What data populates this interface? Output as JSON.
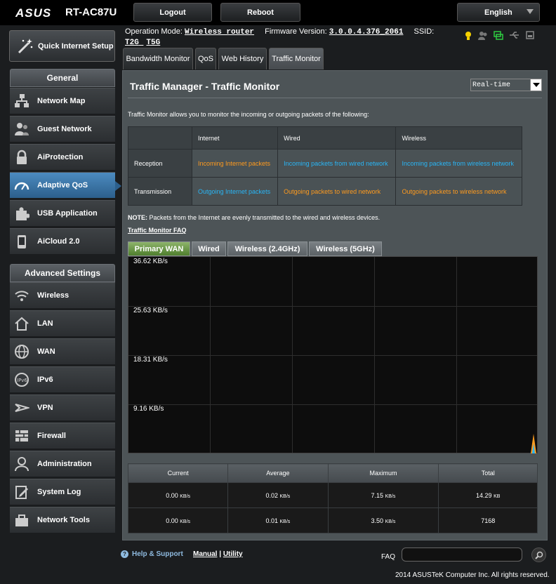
{
  "brand": {
    "logo": "ASUS",
    "model": "RT-AC87U"
  },
  "topbar": {
    "logout": "Logout",
    "reboot": "Reboot",
    "language": "English"
  },
  "sidebar": {
    "quick_setup": "Quick Internet Setup",
    "general_title": "General",
    "general_items": [
      "Network Map",
      "Guest Network",
      "AiProtection",
      "Adaptive QoS",
      "USB Application",
      "AiCloud 2.0"
    ],
    "advanced_title": "Advanced Settings",
    "advanced_items": [
      "Wireless",
      "LAN",
      "WAN",
      "IPv6",
      "VPN",
      "Firewall",
      "Administration",
      "System Log",
      "Network Tools"
    ]
  },
  "header": {
    "op_mode_label": "Operation Mode:",
    "op_mode_value": "Wireless router",
    "firmware_label": "Firmware Version:",
    "firmware_value": "3.0.0.4.376_2061",
    "ssid_label": "SSID:",
    "ssid_1": "T2G",
    "ssid_2": "T5G"
  },
  "tabs": [
    "Bandwidth Monitor",
    "QoS",
    "Web History",
    "Traffic Monitor"
  ],
  "main": {
    "title": "Traffic Manager - Traffic Monitor",
    "mode_select": "Real-time",
    "description": "Traffic Monitor allows you to monitor the incoming or outgoing packets of the following:",
    "legend": {
      "headers": [
        "Internet",
        "Wired",
        "Wireless"
      ],
      "rows": [
        {
          "label": "Reception",
          "cells": [
            "Incoming Internet packets",
            "Incoming packets from wired network",
            "Incoming packets from wireless network"
          ]
        },
        {
          "label": "Transmission",
          "cells": [
            "Outgoing Internet packets",
            "Outgoing packets to wired network",
            "Outgoing packets to wireless network"
          ]
        }
      ]
    },
    "note_bold": "NOTE:",
    "note": " Packets from the Internet are evenly transmitted to the wired and wireless devices.",
    "faq_link": "Traffic Monitor FAQ",
    "graph_tabs": [
      "Primary WAN",
      "Wired",
      "Wireless (2.4GHz)",
      "Wireless (5GHz)"
    ],
    "graph_labels": [
      "36.62 KB/s",
      "25.63 KB/s",
      "18.31 KB/s",
      "9.16 KB/s"
    ],
    "stats": {
      "headers": [
        "Current",
        "Average",
        "Maximum",
        "Total"
      ],
      "rx": {
        "current": "0.00",
        "average": "0.02",
        "maximum": "7.15",
        "total": "14.29",
        "total_unit": "KB"
      },
      "tx": {
        "current": "0.00",
        "average": "0.01",
        "maximum": "3.50",
        "total": "7168",
        "total_unit": ""
      },
      "unit": "KB/s"
    }
  },
  "footer": {
    "help": "Help & Support",
    "manual": "Manual",
    "sep": " | ",
    "utility": "Utility",
    "faq": "FAQ",
    "copyright": "2014 ASUSTeK Computer Inc. All rights reserved."
  },
  "colors": {
    "rx": "#ff9b1e",
    "tx": "#29b6f6",
    "active_nav": "#3b78ab",
    "active_graph_tab": "#6c9a48"
  }
}
